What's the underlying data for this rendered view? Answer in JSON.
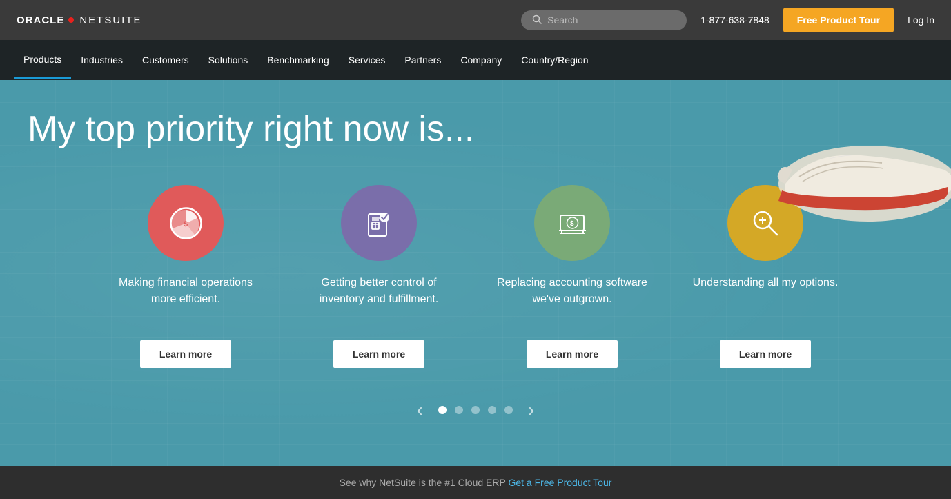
{
  "topbar": {
    "logo_oracle": "ORACLE",
    "logo_netsuite": "NETSUITE",
    "search_placeholder": "Search",
    "phone": "1-877-638-7848",
    "btn_tour": "Free Product Tour",
    "btn_login": "Log In"
  },
  "nav": {
    "items": [
      {
        "label": "Products",
        "active": true
      },
      {
        "label": "Industries",
        "active": false
      },
      {
        "label": "Customers",
        "active": false
      },
      {
        "label": "Solutions",
        "active": false
      },
      {
        "label": "Benchmarking",
        "active": false
      },
      {
        "label": "Services",
        "active": false
      },
      {
        "label": "Partners",
        "active": false
      },
      {
        "label": "Company",
        "active": false
      },
      {
        "label": "Country/Region",
        "active": false
      }
    ]
  },
  "hero": {
    "title": "My top priority right now is...",
    "cards": [
      {
        "icon_name": "pie-chart-icon",
        "icon_color": "red",
        "text": "Making financial operations more efficient.",
        "btn_label": "Learn more"
      },
      {
        "icon_name": "inventory-icon",
        "icon_color": "purple",
        "text": "Getting better control of inventory and fulfillment.",
        "btn_label": "Learn more"
      },
      {
        "icon_name": "accounting-icon",
        "icon_color": "green",
        "text": "Replacing accounting software we've outgrown.",
        "btn_label": "Learn more"
      },
      {
        "icon_name": "search-options-icon",
        "icon_color": "yellow",
        "text": "Understanding all my options.",
        "btn_label": "Learn more"
      }
    ],
    "carousel_dots": [
      true,
      false,
      false,
      false,
      false
    ],
    "prev_arrow": "‹",
    "next_arrow": "›"
  },
  "bottom_bar": {
    "text_before_link": "See why NetSuite is the #1 Cloud ERP ",
    "link_text": "Get a Free Product Tour"
  }
}
